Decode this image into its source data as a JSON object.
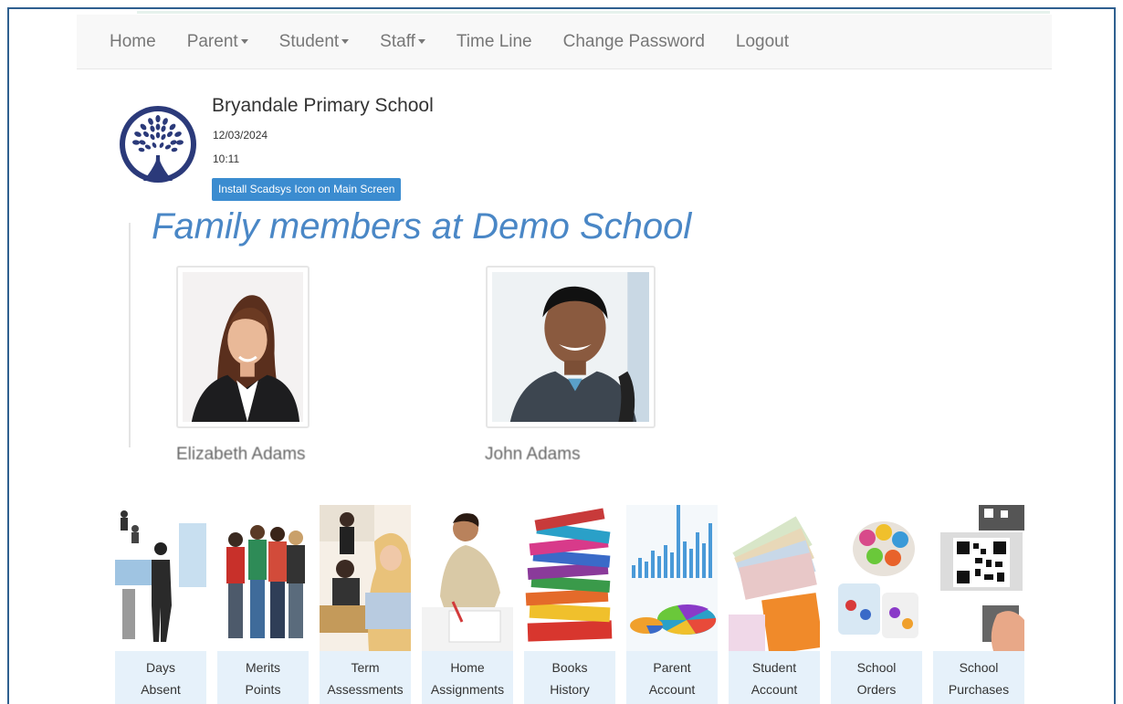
{
  "nav": {
    "home": "Home",
    "parent": "Parent",
    "student": "Student",
    "staff": "Staff",
    "timeline": "Time Line",
    "change_password": "Change Password",
    "logout": "Logout"
  },
  "school": {
    "name": "Bryandale Primary School",
    "date": "12/03/2024",
    "time": "10:11",
    "install_button": "Install Scadsys Icon on Main Screen"
  },
  "family": {
    "title": "Family members at Demo School",
    "members": [
      {
        "name": "Elizabeth Adams"
      },
      {
        "name": "John Adams"
      }
    ]
  },
  "tiles": [
    {
      "line1": "Days",
      "line2": "Absent"
    },
    {
      "line1": "Merits",
      "line2": "Points"
    },
    {
      "line1": "Term",
      "line2": "Assessments"
    },
    {
      "line1": "Home",
      "line2": "Assignments"
    },
    {
      "line1": "Books",
      "line2": "History"
    },
    {
      "line1": "Parent",
      "line2": "Account"
    },
    {
      "line1": "Student",
      "line2": "Account"
    },
    {
      "line1": "School",
      "line2": "Orders"
    },
    {
      "line1": "School",
      "line2": "Purchases"
    }
  ],
  "colors": {
    "accent": "#3b8cd0",
    "title_blue": "#4a87c6",
    "logo_navy": "#2b3a7a",
    "tile_label_bg": "#e6f1fa"
  }
}
